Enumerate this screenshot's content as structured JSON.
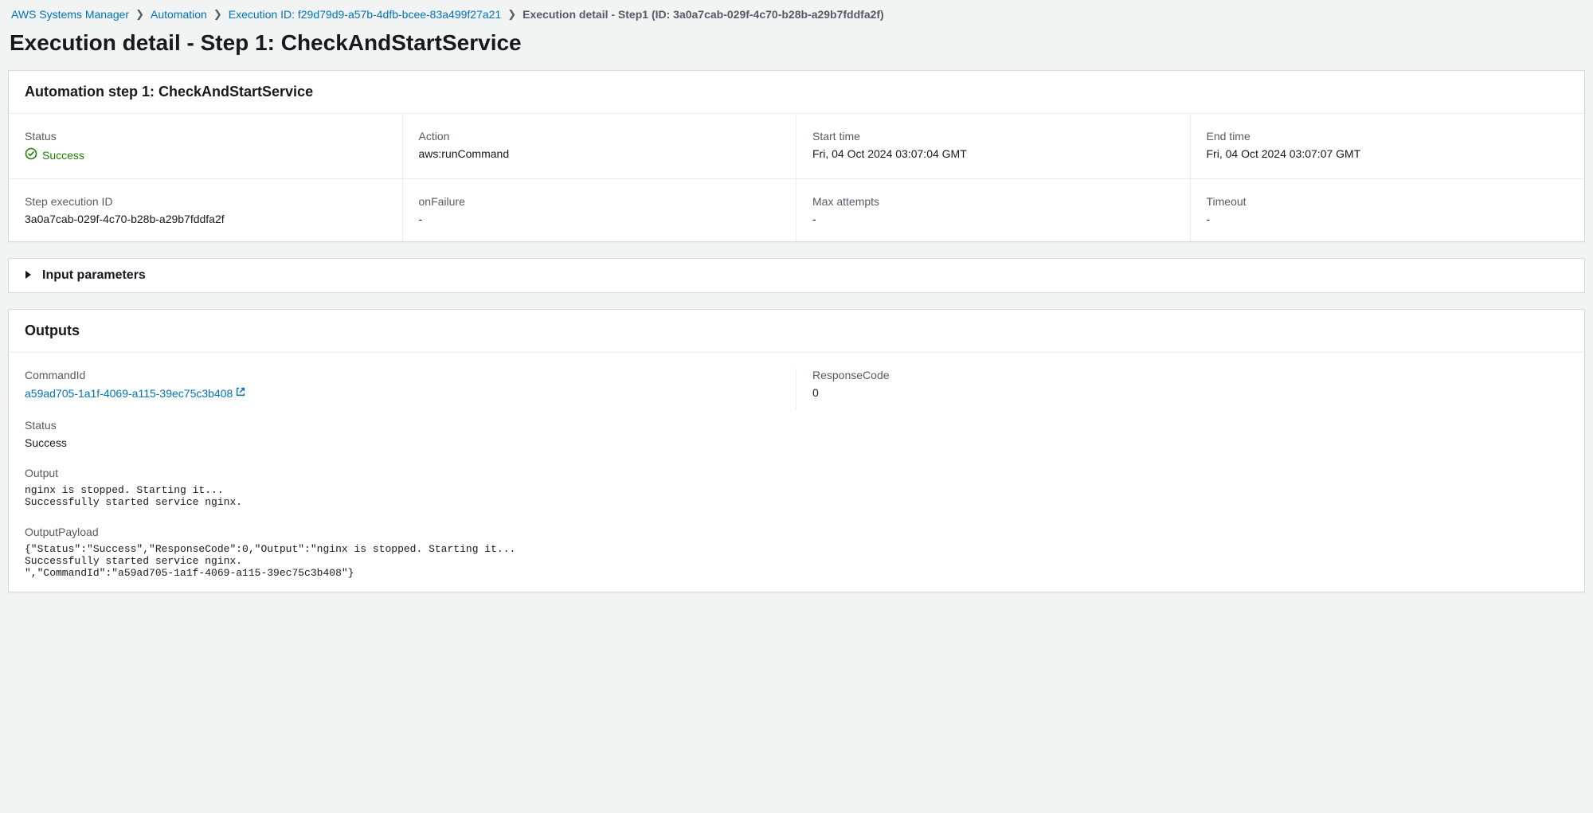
{
  "breadcrumbs": {
    "items": [
      {
        "label": "AWS Systems Manager"
      },
      {
        "label": "Automation"
      },
      {
        "label": "Execution ID: f29d79d9-a57b-4dfb-bcee-83a499f27a21"
      }
    ],
    "current": "Execution detail - Step1 (ID: 3a0a7cab-029f-4c70-b28b-a29b7fddfa2f)"
  },
  "page_title": "Execution detail - Step 1: CheckAndStartService",
  "step_panel": {
    "title": "Automation step 1: CheckAndStartService",
    "fields": {
      "status_label": "Status",
      "status_value": "Success",
      "action_label": "Action",
      "action_value": "aws:runCommand",
      "start_label": "Start time",
      "start_value": "Fri, 04 Oct 2024 03:07:04 GMT",
      "end_label": "End time",
      "end_value": "Fri, 04 Oct 2024 03:07:07 GMT",
      "stepid_label": "Step execution ID",
      "stepid_value": "3a0a7cab-029f-4c70-b28b-a29b7fddfa2f",
      "onfailure_label": "onFailure",
      "onfailure_value": "-",
      "maxatt_label": "Max attempts",
      "maxatt_value": "-",
      "timeout_label": "Timeout",
      "timeout_value": "-"
    }
  },
  "input_params": {
    "title": "Input parameters"
  },
  "outputs": {
    "title": "Outputs",
    "commandid_label": "CommandId",
    "commandid_value": "a59ad705-1a1f-4069-a115-39ec75c3b408",
    "responsecode_label": "ResponseCode",
    "responsecode_value": "0",
    "status_label": "Status",
    "status_value": "Success",
    "output_label": "Output",
    "output_value": "nginx is stopped. Starting it...\nSuccessfully started service nginx.",
    "payload_label": "OutputPayload",
    "payload_value": "{\"Status\":\"Success\",\"ResponseCode\":0,\"Output\":\"nginx is stopped. Starting it...\nSuccessfully started service nginx.\n\",\"CommandId\":\"a59ad705-1a1f-4069-a115-39ec75c3b408\"}"
  }
}
